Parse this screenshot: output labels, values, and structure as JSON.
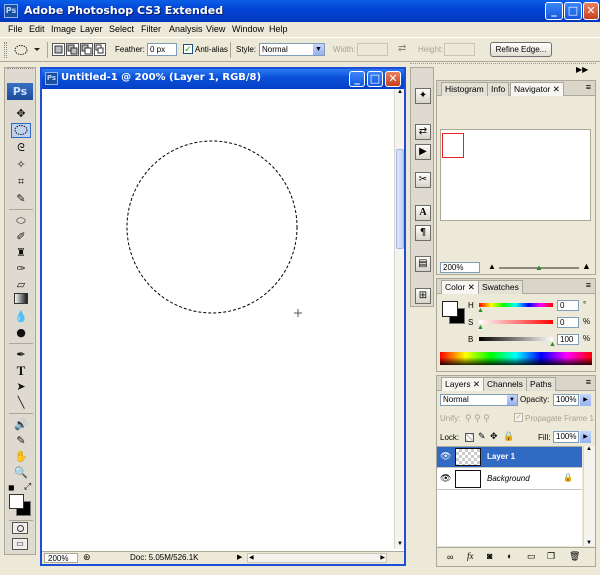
{
  "app": {
    "title": "Adobe Photoshop CS3 Extended",
    "icon_text": "Ps"
  },
  "window_controls": {
    "minimize": "_",
    "maximize": "□",
    "close": "✕"
  },
  "menu": [
    "File",
    "Edit",
    "Image",
    "Layer",
    "Select",
    "Filter",
    "Analysis",
    "View",
    "Window",
    "Help"
  ],
  "options": {
    "feather_label": "Feather:",
    "feather_value": "0 px",
    "antialias_label": "Anti-alias",
    "antialias_checked": true,
    "style_label": "Style:",
    "style_value": "Normal",
    "width_label": "Width:",
    "height_label": "Height:",
    "refine_edge": "Refine Edge..."
  },
  "toolbox": {
    "logo": "Ps"
  },
  "document": {
    "title": "Untitled-1 @ 200% (Layer 1, RGB/8)",
    "zoom": "200%",
    "doc_info": "Doc: 5.05M/526.1K"
  },
  "navigator": {
    "tabs": [
      "Histogram",
      "Info",
      "Navigator"
    ],
    "active_tab": "Navigator",
    "zoom": "200%"
  },
  "color_panel": {
    "tabs": [
      "Color",
      "Swatches"
    ],
    "channels": [
      {
        "label": "H",
        "value": "0",
        "unit": "°"
      },
      {
        "label": "S",
        "value": "0",
        "unit": "%"
      },
      {
        "label": "B",
        "value": "100",
        "unit": "%"
      }
    ]
  },
  "layers_panel": {
    "tabs": [
      "Layers",
      "Channels",
      "Paths"
    ],
    "blend_mode": "Normal",
    "opacity_label": "Opacity:",
    "opacity_value": "100%",
    "unify_label": "Unify:",
    "propagate_label": "Propagate Frame 1",
    "lock_label": "Lock:",
    "fill_label": "Fill:",
    "fill_value": "100%",
    "layers": [
      {
        "name": "Layer 1",
        "selected": true
      },
      {
        "name": "Background",
        "selected": false,
        "locked": true
      }
    ]
  },
  "colors": {
    "accent": "#316ac5",
    "titlebar": "#0a4fd8"
  }
}
